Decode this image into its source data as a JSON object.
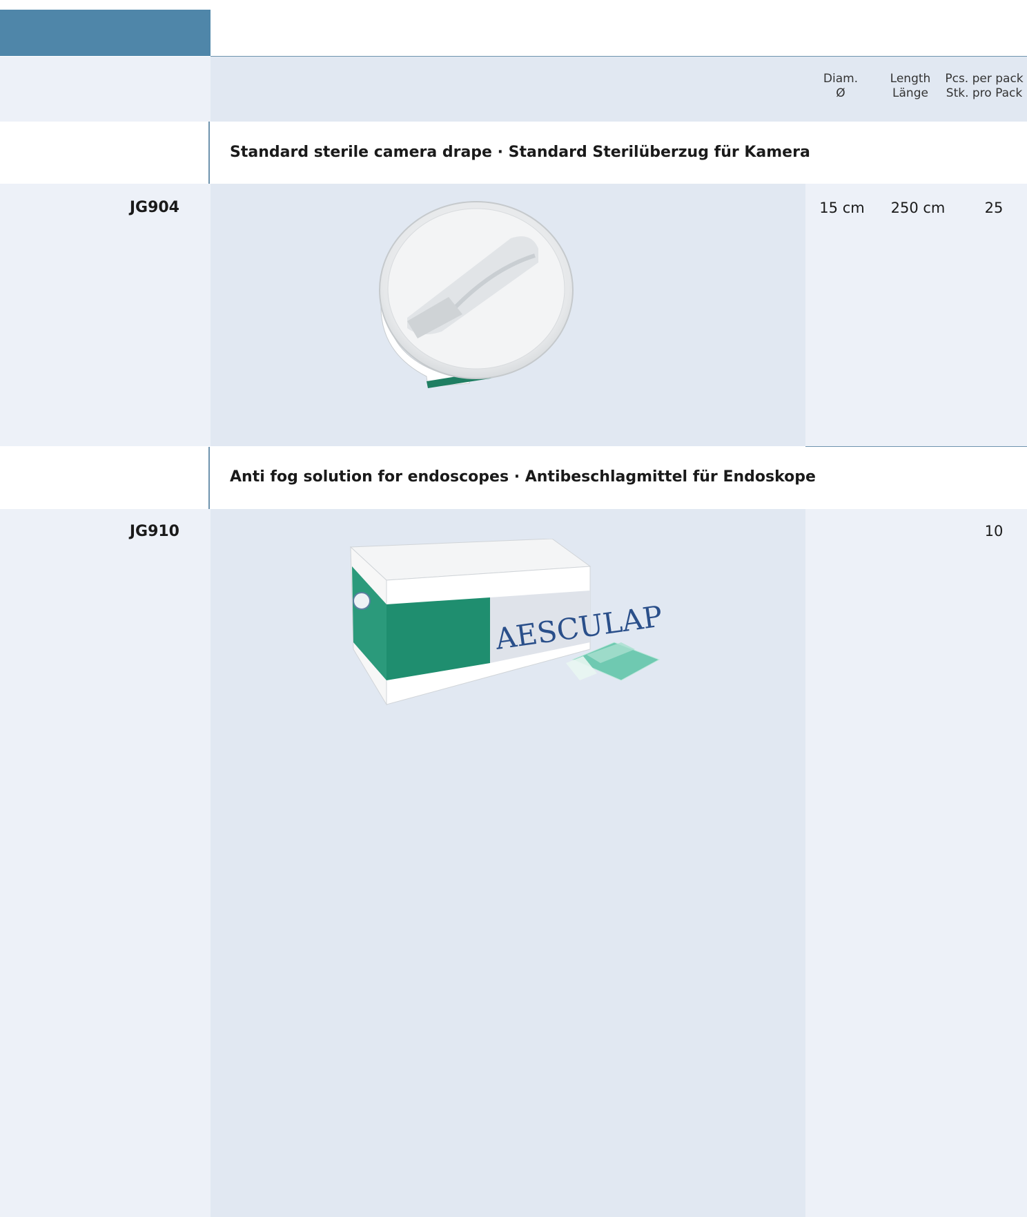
{
  "columns": {
    "diam": {
      "en": "Diam.",
      "de": "Ø"
    },
    "length": {
      "en": "Length",
      "de": "Länge"
    },
    "pcs": {
      "en": "Pcs. per pack",
      "de": "Stk. pro Pack"
    }
  },
  "sections": [
    {
      "title": "Standard sterile camera drape · Standard Sterilüberzug für Kamera",
      "article": "JG904",
      "diam": "15 cm",
      "length": "250 cm",
      "pcs": "25",
      "image_label": "camera drape roll"
    },
    {
      "title": "Anti fog solution for endoscopes · Antibeschlagmittel für Endoskope",
      "article": "JG910",
      "diam": "",
      "length": "",
      "pcs": "10",
      "image_label": "anti fog box",
      "brand_text": "AESCULAP"
    }
  ],
  "colors": {
    "accent": "#4f86a9",
    "rule": "#6e93ad",
    "panel": "#e1e8f2",
    "panel_light": "#edf1f8",
    "teal": "#1f8a6e"
  }
}
